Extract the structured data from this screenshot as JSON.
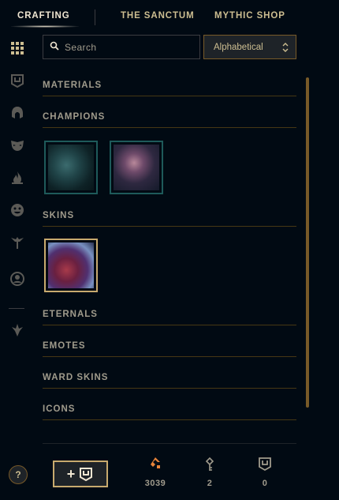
{
  "nav": {
    "tabs": [
      {
        "label": "CRAFTING"
      },
      {
        "label": "THE SANCTUM"
      },
      {
        "label": "MYTHIC SHOP"
      }
    ]
  },
  "sidebar": {
    "icons": [
      "grid-icon",
      "chest-icon",
      "helmet-icon",
      "mask-icon",
      "flame-icon",
      "emote-icon",
      "ward-icon",
      "profile-icon",
      "eternals-icon"
    ]
  },
  "search": {
    "placeholder": "Search",
    "value": ""
  },
  "sort": {
    "selected": "Alphabetical"
  },
  "categories": [
    {
      "label": "MATERIALS"
    },
    {
      "label": "CHAMPIONS"
    },
    {
      "label": "SKINS"
    },
    {
      "label": "ETERNALS"
    },
    {
      "label": "EMOTES"
    },
    {
      "label": "WARD SKINS"
    },
    {
      "label": "ICONS"
    }
  ],
  "footer": {
    "help_label": "?",
    "add_label": "+",
    "currencies": [
      {
        "icon": "orange-essence-icon",
        "count": "3039",
        "color": "#e8843a"
      },
      {
        "icon": "key-icon",
        "count": "2",
        "color": "#a09b8c"
      },
      {
        "icon": "chest-icon",
        "count": "0",
        "color": "#a09b8c"
      }
    ]
  }
}
